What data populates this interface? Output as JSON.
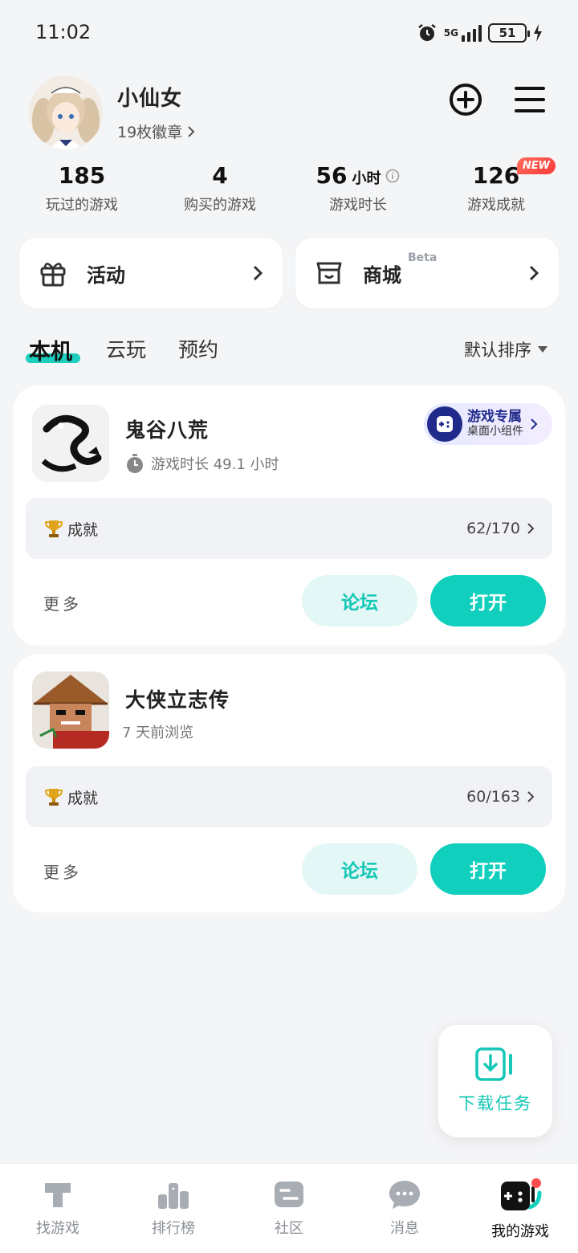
{
  "status_bar": {
    "time": "11:02",
    "network": "5G",
    "battery": "51"
  },
  "profile": {
    "username": "小仙女",
    "badges": "19枚徽章"
  },
  "stats": [
    {
      "value": "185",
      "unit": "",
      "label": "玩过的游戏"
    },
    {
      "value": "4",
      "unit": "",
      "label": "购买的游戏"
    },
    {
      "value": "56",
      "unit": "小时",
      "label": "游戏时长"
    },
    {
      "value": "126",
      "unit": "",
      "label": "游戏成就",
      "badge": "NEW"
    }
  ],
  "actions": {
    "activity": "活动",
    "mall": "商城",
    "mall_tag": "Beta"
  },
  "tabs": {
    "local": "本机",
    "cloud": "云玩",
    "reserve": "预约",
    "sort": "默认排序"
  },
  "games": [
    {
      "name": "鬼谷八荒",
      "subtitle": "游戏时长 49.1 小时",
      "widget_title": "游戏专属",
      "widget_subtitle": "桌面小组件",
      "achievements_label": "成就",
      "achievements_count": "62/170",
      "more": "更多",
      "forum": "论坛",
      "open": "打开"
    },
    {
      "name": "大侠立志传",
      "subtitle": "7 天前浏览",
      "achievements_label": "成就",
      "achievements_count": "60/163",
      "more": "更多",
      "forum": "论坛",
      "open": "打开"
    }
  ],
  "download": {
    "label": "下载任务"
  },
  "nav": [
    {
      "label": "找游戏",
      "icon": "find-games-icon"
    },
    {
      "label": "排行榜",
      "icon": "leaderboard-icon"
    },
    {
      "label": "社区",
      "icon": "community-icon"
    },
    {
      "label": "消息",
      "icon": "message-icon"
    },
    {
      "label": "我的游戏",
      "icon": "my-games-icon"
    }
  ],
  "colors": {
    "accent": "#11cfbd",
    "accent_light": "#e3f8f6",
    "badge_red": "#ff3b3b",
    "widget_navy": "#1f2a8a"
  }
}
